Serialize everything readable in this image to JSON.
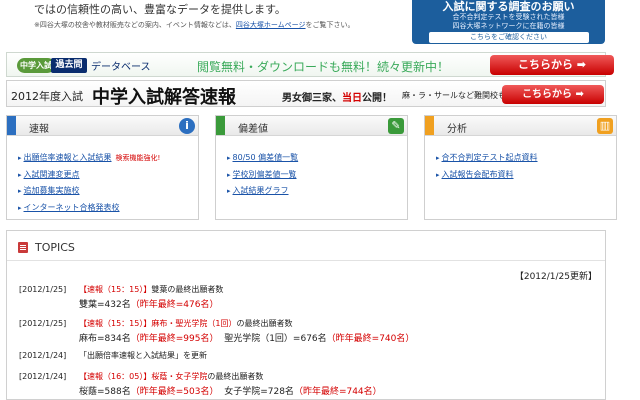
{
  "intro": {
    "line1": "ではの信頼性の高い、豊富なデータを提供します。",
    "line2_prefix": "※四谷大塚の校舎や教材販売などの案内、イベント情報などは、",
    "line2_link": "四谷大塚ホームページ",
    "line2_suffix": "をご覧下さい。"
  },
  "top_banner": {
    "title": "入試に関する調査のお願い",
    "line1": "合不合判定テストを受験された皆様",
    "line2": "四谷大塚ネットワークに在籍の皆様",
    "button": "こちらをご確認ください"
  },
  "db_bar": {
    "logo_left": "中学入試",
    "logo_mid": "過去問",
    "logo_db": "データベース",
    "message": "閲覧無料・ダウンロードも無料！続々更新中！",
    "button": "こちらから ➡"
  },
  "kaito_bar": {
    "year": "2012年度入試",
    "title": "中学入試解答速報",
    "sub_a": "男女御三家、",
    "sub_red": "当日",
    "sub_b": "公開！",
    "sub2": "麻・ラ・サールなど難関校も",
    "button": "こちらから ➡"
  },
  "panels": [
    {
      "title": "速報",
      "icon": "i",
      "items": [
        {
          "label": "出願倍率速報と入試結果",
          "note": "検索機能強化!"
        },
        {
          "label": "入試関連変更点",
          "note": ""
        },
        {
          "label": "追加募集実施校",
          "note": ""
        },
        {
          "label": "インターネット合格発表校",
          "note": ""
        }
      ]
    },
    {
      "title": "偏差値",
      "icon": "✎",
      "items": [
        {
          "label": "80/50 偏差値一覧",
          "note": ""
        },
        {
          "label": "学校別偏差値一覧",
          "note": ""
        },
        {
          "label": "入試結果グラフ",
          "note": ""
        }
      ]
    },
    {
      "title": "分析",
      "icon": "▥",
      "items": [
        {
          "label": "合不合判定テスト起点資料",
          "note": ""
        },
        {
          "label": "入試報告会配布資料",
          "note": ""
        }
      ]
    }
  ],
  "topics": {
    "title": "TOPICS",
    "updated": "【2012/1/25更新】",
    "rows": [
      {
        "date": "[2012/1/25]",
        "red": "【速報（15：15）】",
        "rest": "雙葉の最終出願者数",
        "detail_a": "雙葉=432名",
        "detail_red": "（昨年最終=476名）",
        "detail_b": ""
      },
      {
        "date": "[2012/1/25]",
        "red": "【速報（15：15）】麻布・聖光学院（1回）",
        "rest": "の最終出願者数",
        "detail_a": "麻布=834名",
        "detail_red": "（昨年最終=995名）",
        "detail_b": "聖光学院（1回）=676名",
        "detail_red2": "（昨年最終=740名）"
      },
      {
        "date": "[2012/1/24]",
        "red": "",
        "rest": "「出願倍率速報と入試結果」を更新",
        "detail_a": "",
        "detail_red": "",
        "detail_b": ""
      },
      {
        "date": "[2012/1/24]",
        "red": "【速報（16：05）】桜蔭・女子学院",
        "rest": "の最終出願者数",
        "detail_a": "桜蔭=588名",
        "detail_red": "（昨年最終=503名）",
        "detail_b": "女子学院=728名",
        "detail_red2": "（昨年最終=744名）"
      }
    ]
  },
  "colors": {
    "panel1": "#2c6fc0",
    "panel2": "#3a9a3a",
    "panel3": "#f0a020",
    "accent_red": "#d40000"
  }
}
